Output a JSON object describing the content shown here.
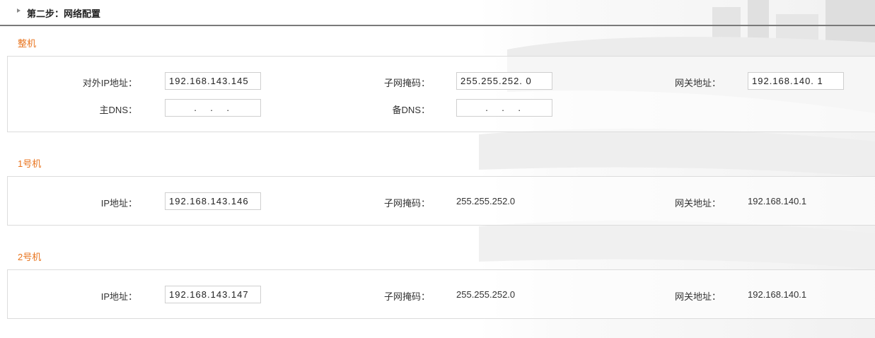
{
  "step": {
    "title": "第二步：网络配置"
  },
  "groups": {
    "whole": {
      "title": "整机",
      "ext_ip_label": "对外IP地址：",
      "ext_ip_value": "192.168.143.145",
      "mask_label": "子网掩码：",
      "mask_value": "255.255.252. 0",
      "gateway_label": "网关地址：",
      "gateway_value": "192.168.140. 1",
      "dns1_label": "主DNS：",
      "dns1_value": "  .    .    .  ",
      "dns2_label": "备DNS：",
      "dns2_value": "  .    .    .  "
    },
    "unit1": {
      "title": "1号机",
      "ip_label": "IP地址：",
      "ip_value": "192.168.143.146",
      "mask_label": "子网掩码：",
      "mask_value": "255.255.252.0",
      "gateway_label": "网关地址：",
      "gateway_value": "192.168.140.1"
    },
    "unit2": {
      "title": "2号机",
      "ip_label": "IP地址：",
      "ip_value": "192.168.143.147",
      "mask_label": "子网掩码：",
      "mask_value": "255.255.252.0",
      "gateway_label": "网关地址：",
      "gateway_value": "192.168.140.1"
    }
  }
}
